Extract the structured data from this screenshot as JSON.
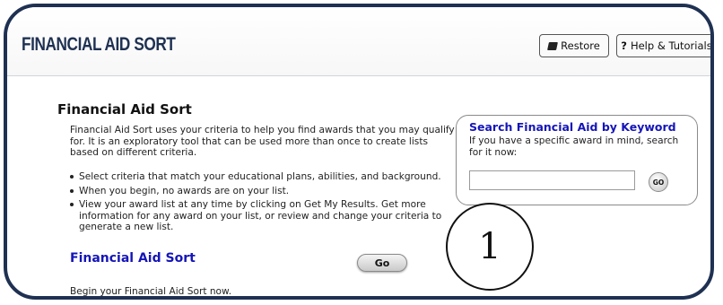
{
  "header": {
    "title": "FINANCIAL AID SORT",
    "restore_label": "Restore",
    "help_label": "Help & Tutorials"
  },
  "main": {
    "heading": "Financial Aid Sort",
    "intro": "Financial Aid Sort uses your criteria to help you find awards that you may qualify for. It is an exploratory tool that can be used more than once to create lists based on different criteria.",
    "bullets": [
      "Select criteria that match your educational plans, abilities, and background.",
      "When you begin, no awards are on your list.",
      "View your award list at any time by clicking on Get My Results. Get more information for any award on your list, or review and change your criteria to generate a new list."
    ],
    "sort_link_label": "Financial Aid Sort",
    "go_label": "Go",
    "begin_text": "Begin your Financial Aid Sort now."
  },
  "search": {
    "title": "Search Financial Aid by Keyword",
    "description": "If you have a specific award in mind, search for it now:",
    "input_value": "",
    "go_label": "GO"
  },
  "annotation": {
    "number": "1"
  },
  "colors": {
    "frame_border": "#1f3152",
    "header_title": "#1f3152",
    "link_blue": "#1515b8"
  },
  "icons": {
    "restore": "book-icon",
    "help": "question-mark-icon"
  }
}
